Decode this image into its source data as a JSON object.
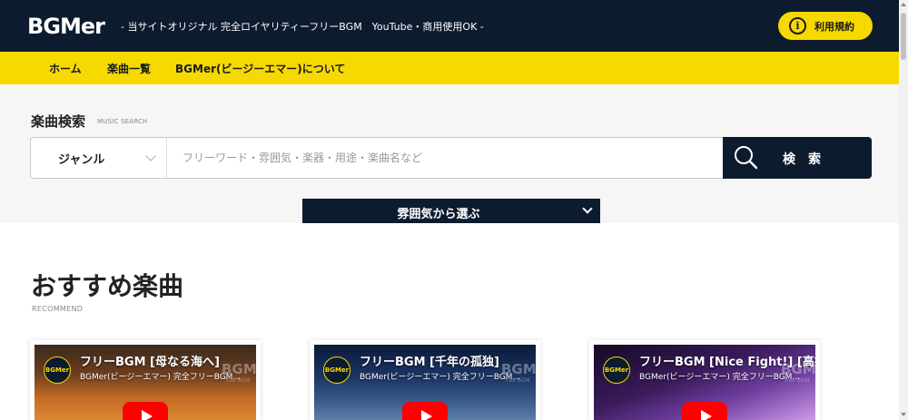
{
  "header": {
    "logo": "BGMer",
    "tagline": "- 当サイトオリジナル 完全ロイヤリティーフリーBGM　YouTube・商用使用OK -",
    "terms_icon": "i",
    "terms_label": "利用規約"
  },
  "nav": {
    "items": [
      {
        "label": "ホーム"
      },
      {
        "label": "楽曲一覧"
      },
      {
        "label": "BGMer(ビージーエマー)について"
      }
    ]
  },
  "search": {
    "title": "楽曲検索",
    "subtitle": "MUSIC SEARCH",
    "genre_label": "ジャンル",
    "placeholder": "フリーワード・雰囲気・楽器・用途・楽曲名など",
    "button_label": "検索",
    "mood_label": "雰囲気から選ぶ"
  },
  "recommend": {
    "title": "おすすめ楽曲",
    "subtitle": "RECOMMEND",
    "cards": [
      {
        "title": "フリーBGM [母なる海へ]",
        "channel": "BGMer(ビージーエマー) 完全フリーBGM...",
        "avatar": "BGMer",
        "watermark": "BGMer",
        "watermark_sub": "free BGM"
      },
      {
        "title": "フリーBGM [千年の孤独]",
        "channel": "BGMer(ビージーエマー) 完全フリーBGM...",
        "avatar": "BGMer",
        "watermark": "BGMer",
        "watermark_sub": "free BGM"
      },
      {
        "title": "フリーBGM [Nice Fight!] [高揚",
        "channel": "BGMer(ビージーエマー) 完全フリーBGM...",
        "avatar": "BGMer",
        "watermark": "BGMer",
        "watermark_sub": "free BGM"
      }
    ]
  },
  "colors": {
    "navy": "#0d1b2e",
    "yellow": "#f6d900"
  }
}
